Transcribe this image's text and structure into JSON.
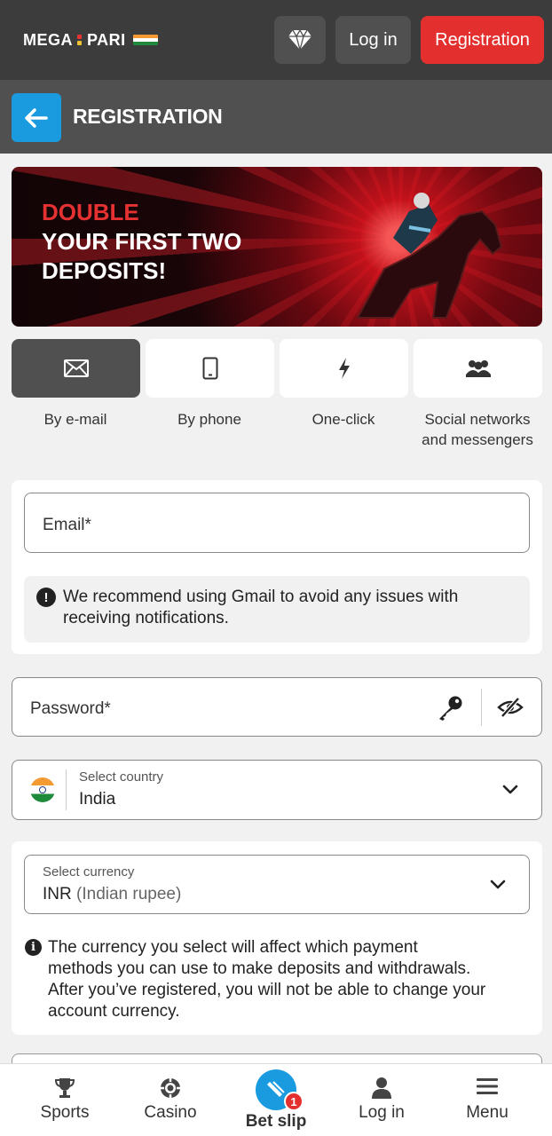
{
  "header": {
    "logo_text_1": "MEGA",
    "logo_text_2": "PARI",
    "login_label": "Log in",
    "registration_label": "Registration"
  },
  "subheader": {
    "title": "REGISTRATION"
  },
  "banner": {
    "line1": "DOUBLE",
    "line2": "YOUR FIRST TWO",
    "line3": "DEPOSITS!"
  },
  "tabs": [
    {
      "label": "By e-mail",
      "icon": "envelope-icon",
      "active": true
    },
    {
      "label": "By phone",
      "icon": "phone-icon",
      "active": false
    },
    {
      "label": "One-click",
      "icon": "lightning-icon",
      "active": false
    },
    {
      "label_line1": "Social networks",
      "label_line2": "and messengers",
      "icon": "people-icon",
      "active": false
    }
  ],
  "email_section": {
    "placeholder": "Email*",
    "note_line1": "We recommend using Gmail to avoid any issues with",
    "note_line2": "receiving notifications."
  },
  "password": {
    "placeholder": "Password*"
  },
  "country": {
    "label": "Select country",
    "value": "India"
  },
  "currency": {
    "label": "Select currency",
    "code": "INR",
    "name": "(Indian rupee)",
    "note_line1": "The currency you select will affect which payment",
    "note_line2": "methods you can use to make deposits and withdrawals.",
    "note_line3": "After you’ve registered, you will not be able to change your",
    "note_line4": "account currency."
  },
  "bottom_nav": {
    "items": [
      {
        "label": "Sports",
        "icon": "trophy-icon"
      },
      {
        "label": "Casino",
        "icon": "casino-chip-icon"
      },
      {
        "label": "Bet slip",
        "icon": "ticket-icon",
        "badge": "1"
      },
      {
        "label": "Log in",
        "icon": "user-icon"
      },
      {
        "label": "Menu",
        "icon": "hamburger-icon"
      }
    ]
  },
  "colors": {
    "accent_red": "#e3302f",
    "accent_blue": "#1a9be0",
    "header_bg": "#3c3c3c",
    "subheader_bg": "#505050"
  }
}
